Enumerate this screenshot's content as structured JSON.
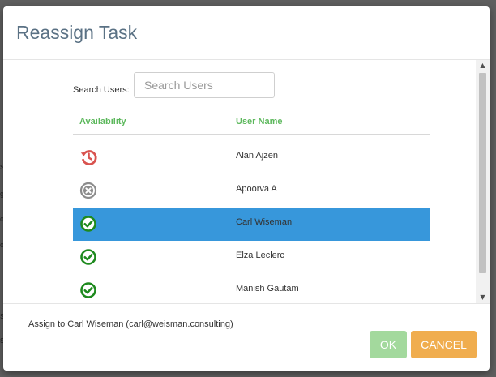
{
  "background": {
    "fragments": [
      "s",
      "g",
      "o",
      "o",
      "s",
      "s"
    ]
  },
  "dialog": {
    "title": "Reassign Task"
  },
  "search": {
    "label": "Search Users:",
    "placeholder": "Search Users",
    "value": ""
  },
  "table": {
    "columns": [
      "Availability",
      "User Name"
    ],
    "rows": [
      {
        "availability": "recent-history-icon",
        "user_name": "Alan Ajzen",
        "selected": false
      },
      {
        "availability": "unavailable-icon",
        "user_name": "Apoorva A",
        "selected": false
      },
      {
        "availability": "available-icon",
        "user_name": "Carl Wiseman",
        "selected": true
      },
      {
        "availability": "available-icon",
        "user_name": "Elza Leclerc",
        "selected": false
      },
      {
        "availability": "available-icon",
        "user_name": "Manish Gautam",
        "selected": false
      }
    ]
  },
  "footer": {
    "assign_text": "Assign to Carl Wiseman (carl@weisman.consulting)",
    "ok_label": "OK",
    "cancel_label": "CANCEL"
  },
  "colors": {
    "title": "#5a7184",
    "header_green": "#5cb85c",
    "selected_row": "#3797db",
    "ok_button": "#a3d99d",
    "cancel_button": "#f0ad4e",
    "available": "#1e8a1e",
    "unavailable": "#8c8c8c",
    "recent": "#d9534f"
  }
}
